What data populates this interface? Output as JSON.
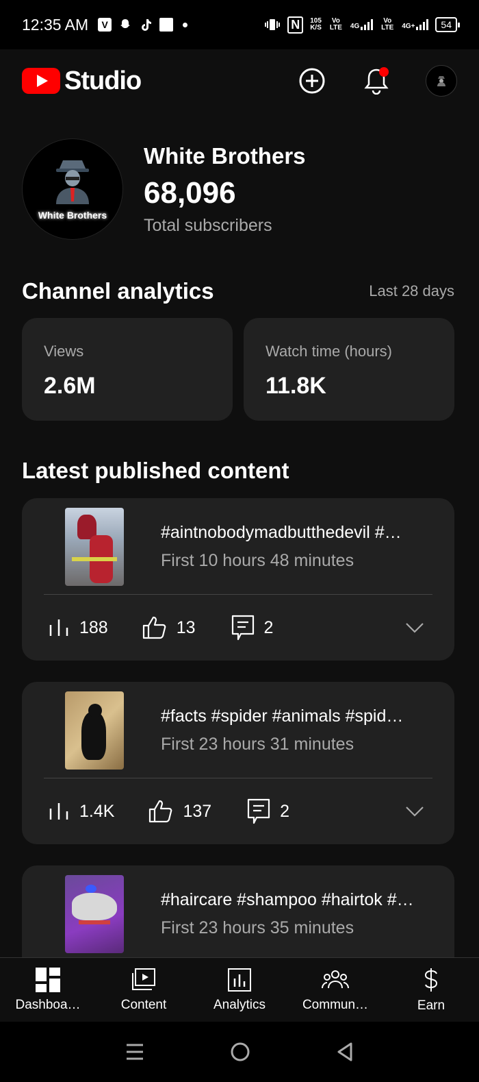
{
  "status_bar": {
    "time": "12:35 AM",
    "net_speed": "105",
    "net_unit": "K/S",
    "sim1": "Vo LTE",
    "sim1_net": "4G",
    "sim2": "Vo LTE",
    "sim2_net": "4G+",
    "battery": "54"
  },
  "header": {
    "app_name": "Studio",
    "brand_color": "#ff0000",
    "icons": [
      "create-icon",
      "notification-bell-icon",
      "account-avatar"
    ]
  },
  "channel": {
    "name": "White Brothers",
    "avatar_label": "White Brothers",
    "subscribers": "68,096",
    "subscribers_label": "Total subscribers"
  },
  "analytics": {
    "title": "Channel analytics",
    "range": "Last 28 days",
    "cards": [
      {
        "label": "Views",
        "value": "2.6M"
      },
      {
        "label": "Watch time (hours)",
        "value": "11.8K"
      }
    ]
  },
  "latest": {
    "title": "Latest published content",
    "items": [
      {
        "title": "#aintnobodymadbutthedevil #…",
        "subtitle": "First 10 hours 48 minutes",
        "views": "188",
        "likes": "13",
        "comments": "2"
      },
      {
        "title": "#facts #spider #animals #spid…",
        "subtitle": "First 23 hours 31 minutes",
        "views": "1.4K",
        "likes": "137",
        "comments": "2"
      },
      {
        "title": "#haircare #shampoo #hairtok #…",
        "subtitle": "First 23 hours 35 minutes"
      }
    ]
  },
  "bottom_nav": [
    {
      "label": "Dashboa…",
      "icon": "dashboard-icon"
    },
    {
      "label": "Content",
      "icon": "content-icon"
    },
    {
      "label": "Analytics",
      "icon": "analytics-icon"
    },
    {
      "label": "Commun…",
      "icon": "community-icon"
    },
    {
      "label": "Earn",
      "icon": "earn-icon"
    }
  ]
}
